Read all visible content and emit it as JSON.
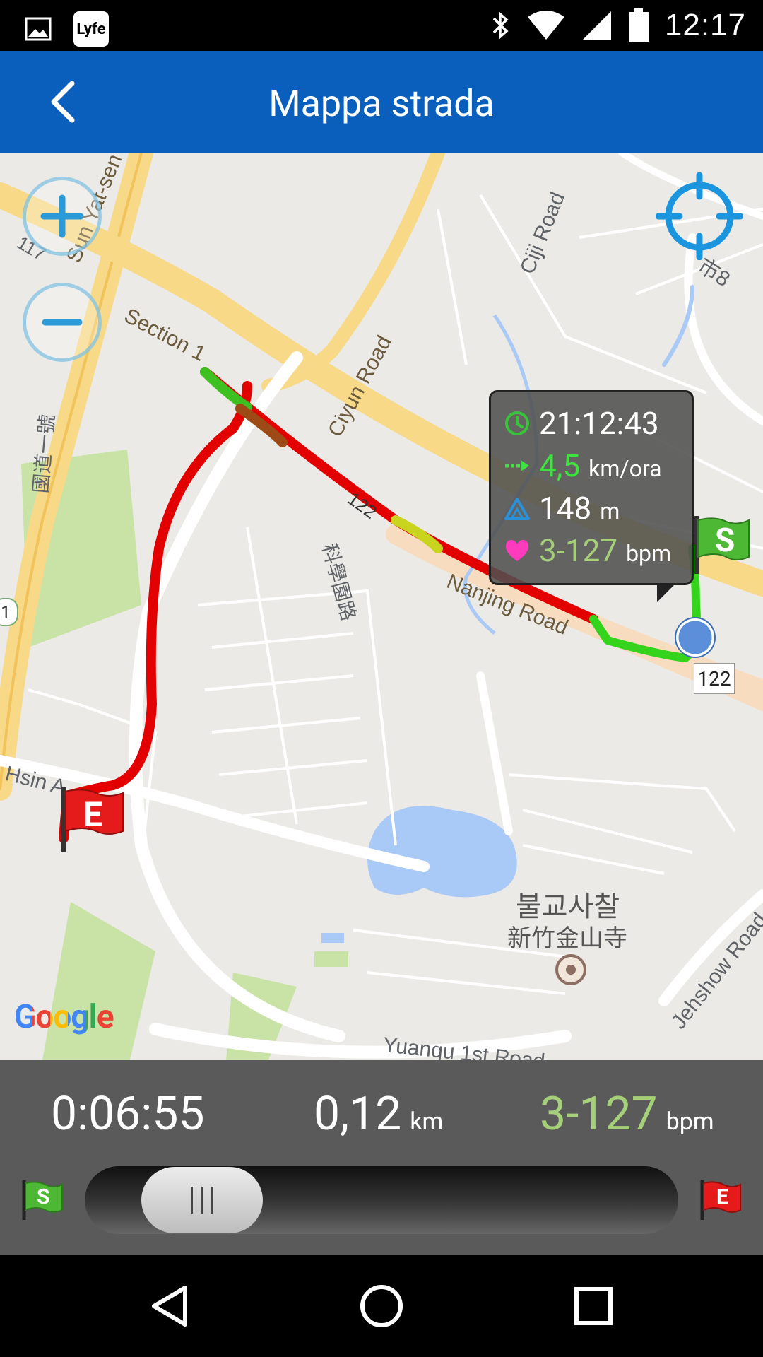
{
  "status_bar": {
    "time": "12:17",
    "app_icon_text": "Lyfe",
    "icons": [
      "image-icon",
      "lyfe-app-icon",
      "bluetooth-icon",
      "wifi-icon",
      "cellular-icon",
      "battery-icon"
    ]
  },
  "app_bar": {
    "title": "Mappa strada",
    "back_icon": "chevron-left-icon",
    "color": "#0a5fbd"
  },
  "map": {
    "labels": {
      "sun_yat_sen": "Sun Yat-sen Fwy",
      "section": "Section 1",
      "ciyun": "Ciyun Road",
      "ciji": "Ciji Road",
      "city8": "市8",
      "road117": "117",
      "nanjing": "Nanjing Road",
      "science": "科學園路",
      "national": "國道一號",
      "hsin": "Hsin A",
      "temple_ko": "불교사찰",
      "temple_zh": "新竹金山寺",
      "jehshow": "Jehshow Road",
      "yuanqu": "Yuanqu 1st Road",
      "route_badge": "122",
      "edge_badge": "1",
      "road122": "122"
    },
    "google_logo": "Google",
    "start_flag_letter": "S",
    "end_flag_letter": "E"
  },
  "bubble": {
    "time": "21:12:43",
    "speed": "4,5",
    "speed_unit": "km/ora",
    "altitude": "148",
    "altitude_unit": "m",
    "heart": "3-127",
    "heart_unit": "bpm",
    "colors": {
      "speed": "#3ee33e",
      "heart": "#a6cf7a",
      "time_icon": "#3ac23a",
      "alt_icon": "#2a90d8",
      "heart_icon": "#ff3bbd"
    }
  },
  "stats": {
    "duration": "0:06:55",
    "distance": "0,12",
    "distance_unit": "km",
    "heart_rate": "3-127",
    "heart_rate_unit": "bpm"
  },
  "playback": {
    "start_letter": "S",
    "end_letter": "E",
    "progress": 0.0
  }
}
